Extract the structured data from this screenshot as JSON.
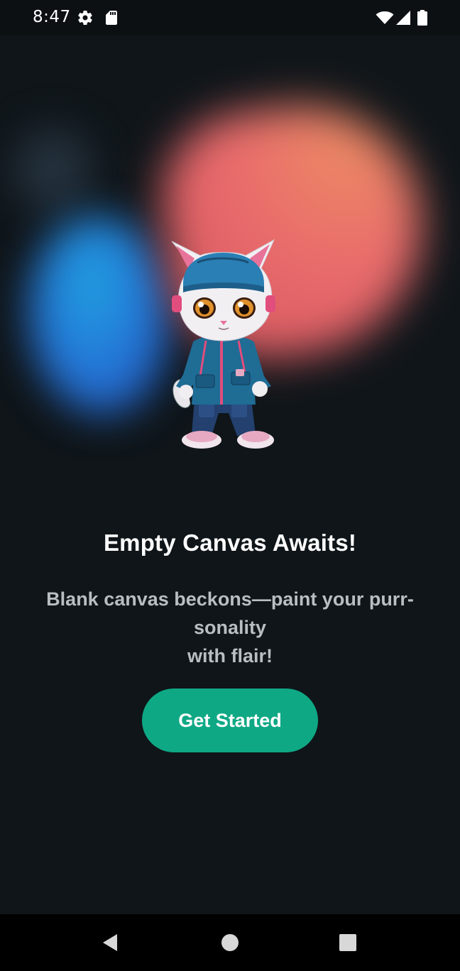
{
  "status_bar": {
    "time": "8:47",
    "icons": [
      "settings-gear-icon",
      "sd-card-icon",
      "wifi-icon",
      "signal-icon",
      "battery-icon"
    ]
  },
  "illustration": {
    "subject": "cat-character-icon"
  },
  "content": {
    "title": "Empty Canvas Awaits!",
    "subtitle_line1": "Blank canvas beckons—paint your purr-sonality",
    "subtitle_line2": "with flair!",
    "button_label": "Get Started"
  },
  "colors": {
    "background": "#0f1519",
    "accent": "#0fa885",
    "title_text": "#ffffff",
    "subtitle_text": "#b9bec2"
  },
  "nav_bar": {
    "buttons": [
      "back-icon",
      "home-icon",
      "recents-icon"
    ]
  }
}
